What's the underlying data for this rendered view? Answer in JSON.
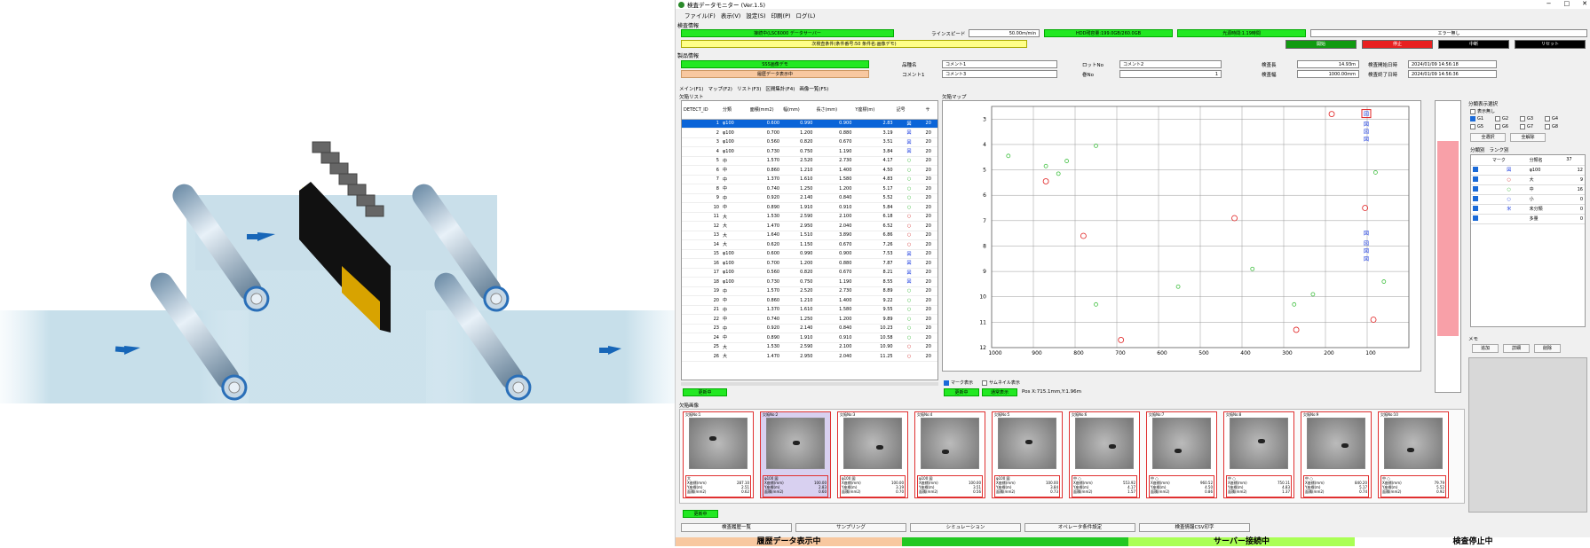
{
  "window": {
    "title": "検査データモニター (Ver.1.5)"
  },
  "menu": [
    "ファイル(F)",
    "表示(V)",
    "設定(S)",
    "印刷(P)",
    "ログ(L)"
  ],
  "inspection_info": {
    "section": "検査情報",
    "status_main": "接続中(LSC6000 データサーバー",
    "line_speed_label": "ラインスピード",
    "line_speed": "50.00m/min",
    "hdd": "HDD残容量:199.0GB/260.0GB",
    "light": "光源時間:1.19時間",
    "error": "エラー無し",
    "condition": "次検査条件(条件番号:50 条件名:画像デモ)",
    "buttons": [
      "開始",
      "停止",
      "中断",
      "リセット"
    ]
  },
  "product_info": {
    "section": "製品情報",
    "mode1": "SSS画像デモ",
    "mode2": "履歴データ表示中",
    "fields": [
      {
        "label": "品種名",
        "value": "コメント1"
      },
      {
        "label": "コメント1",
        "value": "コメント3"
      },
      {
        "label": "ロットNo",
        "value": "コメント2"
      },
      {
        "label": "巻No",
        "value": "1"
      },
      {
        "label": "検査長",
        "value": "14.93m"
      },
      {
        "label": "検査幅",
        "value": "1000.00mm"
      },
      {
        "label": "検査開始日時",
        "value": "2024/01/09 14:56:18"
      },
      {
        "label": "検査終了日時",
        "value": "2024/01/09 14:56:36"
      }
    ]
  },
  "main_tabs": [
    "メイン(F1)",
    "マップ(F2)",
    "リスト(F3)",
    "区間集計(F4)",
    "画像一覧(F5)"
  ],
  "defect_list": {
    "title": "欠陥リスト",
    "headers": [
      "DETECT_ID",
      "分類",
      "面積(mm2)",
      "幅(mm)",
      "長さ(mm)",
      "Y座標(m)",
      "記号",
      "サ"
    ],
    "rows": [
      [
        "1",
        "φ100",
        "0.600",
        "0.990",
        "0.900",
        "2.83",
        "図",
        "20"
      ],
      [
        "2",
        "φ100",
        "0.700",
        "1.200",
        "0.880",
        "3.19",
        "図",
        "20"
      ],
      [
        "3",
        "φ100",
        "0.560",
        "0.820",
        "0.670",
        "3.51",
        "図",
        "20"
      ],
      [
        "4",
        "φ100",
        "0.730",
        "0.750",
        "1.190",
        "3.84",
        "図",
        "20"
      ],
      [
        "5",
        "中",
        "1.570",
        "2.520",
        "2.730",
        "4.17",
        "○",
        "20"
      ],
      [
        "6",
        "中",
        "0.860",
        "1.210",
        "1.400",
        "4.50",
        "○",
        "20"
      ],
      [
        "7",
        "中",
        "1.370",
        "1.610",
        "1.580",
        "4.83",
        "○",
        "20"
      ],
      [
        "8",
        "中",
        "0.740",
        "1.250",
        "1.200",
        "5.17",
        "○",
        "20"
      ],
      [
        "9",
        "中",
        "0.920",
        "2.140",
        "0.840",
        "5.52",
        "○",
        "20"
      ],
      [
        "10",
        "中",
        "0.890",
        "1.910",
        "0.910",
        "5.84",
        "○",
        "20"
      ],
      [
        "11",
        "大",
        "1.530",
        "2.590",
        "2.100",
        "6.18",
        "○",
        "20"
      ],
      [
        "12",
        "大",
        "1.470",
        "2.950",
        "2.040",
        "6.52",
        "○",
        "20"
      ],
      [
        "13",
        "大",
        "1.640",
        "1.510",
        "3.890",
        "6.86",
        "○",
        "20"
      ],
      [
        "14",
        "大",
        "0.620",
        "1.150",
        "0.670",
        "7.26",
        "○",
        "20"
      ],
      [
        "15",
        "φ100",
        "0.600",
        "0.990",
        "0.900",
        "7.53",
        "図",
        "20"
      ],
      [
        "16",
        "φ100",
        "0.700",
        "1.200",
        "0.880",
        "7.87",
        "図",
        "20"
      ],
      [
        "17",
        "φ100",
        "0.560",
        "0.820",
        "0.670",
        "8.21",
        "図",
        "20"
      ],
      [
        "18",
        "φ100",
        "0.730",
        "0.750",
        "1.190",
        "8.55",
        "図",
        "20"
      ],
      [
        "19",
        "中",
        "1.570",
        "2.520",
        "2.730",
        "8.89",
        "○",
        "20"
      ],
      [
        "20",
        "中",
        "0.860",
        "1.210",
        "1.400",
        "9.22",
        "○",
        "20"
      ],
      [
        "21",
        "中",
        "1.370",
        "1.610",
        "1.580",
        "9.55",
        "○",
        "20"
      ],
      [
        "22",
        "中",
        "0.740",
        "1.250",
        "1.200",
        "9.89",
        "○",
        "20"
      ],
      [
        "23",
        "中",
        "0.920",
        "2.140",
        "0.840",
        "10.23",
        "○",
        "20"
      ],
      [
        "24",
        "中",
        "0.890",
        "1.910",
        "0.910",
        "10.58",
        "○",
        "20"
      ],
      [
        "25",
        "大",
        "1.530",
        "2.590",
        "2.100",
        "10.90",
        "○",
        "20"
      ],
      [
        "26",
        "大",
        "1.470",
        "2.950",
        "2.040",
        "11.25",
        "○",
        "20"
      ]
    ],
    "updating": "更新中"
  },
  "defect_map": {
    "title": "欠陥マップ",
    "x_ticks": [
      "1000",
      "900",
      "800",
      "700",
      "600",
      "500",
      "400",
      "300",
      "200",
      "100"
    ],
    "y_ticks": [
      "3",
      "4",
      "5",
      "6",
      "7",
      "8",
      "9",
      "10",
      "11",
      "12"
    ],
    "mark_display": "マーク表示",
    "thumbnail_display": "サムネイル表示",
    "updating": "更新中",
    "normal_display": "通常表示",
    "position": "Pos X:715.1mm,Y:1.96m"
  },
  "filter": {
    "title": "分類表示選択",
    "none": "表示無し",
    "groups": [
      "G1",
      "G2",
      "G3",
      "G4",
      "G5",
      "G6",
      "G7",
      "G8"
    ],
    "select_all": "全選択",
    "deselect_all": "全解除",
    "tabs": [
      "分類別",
      "ランク別"
    ],
    "headers": [
      "マーク",
      "分類名",
      "37"
    ],
    "rows": [
      {
        "mark": "図",
        "name": "φ100",
        "count": "12"
      },
      {
        "mark": "○",
        "name": "大",
        "count": "9"
      },
      {
        "mark": "○",
        "name": "中",
        "count": "16"
      },
      {
        "mark": "○",
        "name": "小",
        "count": "0"
      },
      {
        "mark": "米",
        "name": "未分類",
        "count": "0"
      },
      {
        "mark": "",
        "name": "多量",
        "count": "0"
      }
    ]
  },
  "memo": {
    "title": "メモ",
    "buttons": [
      "追加",
      "詳細",
      "削除"
    ]
  },
  "defect_images": {
    "title": "欠陥画像",
    "updating": "更新中",
    "items": [
      {
        "no": "欠陥No:1",
        "cls": "大",
        "x": "287.10",
        "y": "2.51",
        "area": "0.62"
      },
      {
        "no": "欠陥No:2",
        "cls": "φ100 図",
        "x": "100.00",
        "y": "2.83",
        "area": "0.60"
      },
      {
        "no": "欠陥No:3",
        "cls": "φ100 図",
        "x": "100.00",
        "y": "3.19",
        "area": "0.70"
      },
      {
        "no": "欠陥No:4",
        "cls": "φ100 図",
        "x": "100.00",
        "y": "3.51",
        "area": "0.56"
      },
      {
        "no": "欠陥No:5",
        "cls": "φ100 図",
        "x": "100.00",
        "y": "3.84",
        "area": "0.73"
      },
      {
        "no": "欠陥No:6",
        "cls": "中 ○",
        "x": "553.92",
        "y": "4.17",
        "area": "1.57"
      },
      {
        "no": "欠陥No:7",
        "cls": "中 ○",
        "x": "960.52",
        "y": "4.50",
        "area": "0.86"
      },
      {
        "no": "欠陥No:8",
        "cls": "中 ○",
        "x": "750.11",
        "y": "4.83",
        "area": "1.37"
      },
      {
        "no": "欠陥No:9",
        "cls": "中 ○",
        "x": "840.20",
        "y": "5.17",
        "area": "0.74"
      },
      {
        "no": "欠陥No:10",
        "cls": "中 ○",
        "x": "79.79",
        "y": "5.52",
        "area": "0.92"
      }
    ],
    "labels": {
      "x": "X座標(mm)",
      "y": "Y座標(m)",
      "area": "面積(mm2)"
    }
  },
  "bottom_buttons": [
    "検査履歴一覧",
    "サンプリング",
    "シミュレーション",
    "オペレータ条件設定",
    "検査情報CSV印字"
  ],
  "status_bar": [
    "履歴データ表示中",
    "",
    "サーバー接続中",
    "検査停止中"
  ],
  "colors": {
    "green": "#22e822",
    "yellow": "#ffff88",
    "orange": "#f8c8a0",
    "selected": "#0a64d8",
    "red": "#e03030"
  },
  "map_points": [
    {
      "x": 870,
      "y": 5.45,
      "c": "r"
    },
    {
      "x": 780,
      "y": 7.6,
      "c": "r"
    },
    {
      "x": 690,
      "y": 11.7,
      "c": "r"
    },
    {
      "x": 418,
      "y": 6.9,
      "c": "r"
    },
    {
      "x": 185,
      "y": 2.8,
      "c": "r"
    },
    {
      "x": 105,
      "y": 6.5,
      "c": "r"
    },
    {
      "x": 85,
      "y": 10.9,
      "c": "r"
    },
    {
      "x": 270,
      "y": 11.3,
      "c": "r"
    },
    {
      "x": 960,
      "y": 4.45,
      "c": "g"
    },
    {
      "x": 870,
      "y": 4.85,
      "c": "g"
    },
    {
      "x": 820,
      "y": 4.65,
      "c": "g"
    },
    {
      "x": 750,
      "y": 4.05,
      "c": "g"
    },
    {
      "x": 750,
      "y": 10.3,
      "c": "g"
    },
    {
      "x": 840,
      "y": 5.15,
      "c": "g"
    },
    {
      "x": 553,
      "y": 9.6,
      "c": "g"
    },
    {
      "x": 375,
      "y": 8.9,
      "c": "g"
    },
    {
      "x": 275,
      "y": 10.3,
      "c": "g"
    },
    {
      "x": 230,
      "y": 9.9,
      "c": "g"
    },
    {
      "x": 80,
      "y": 5.1,
      "c": "g"
    },
    {
      "x": 60,
      "y": 9.4,
      "c": "g"
    }
  ]
}
